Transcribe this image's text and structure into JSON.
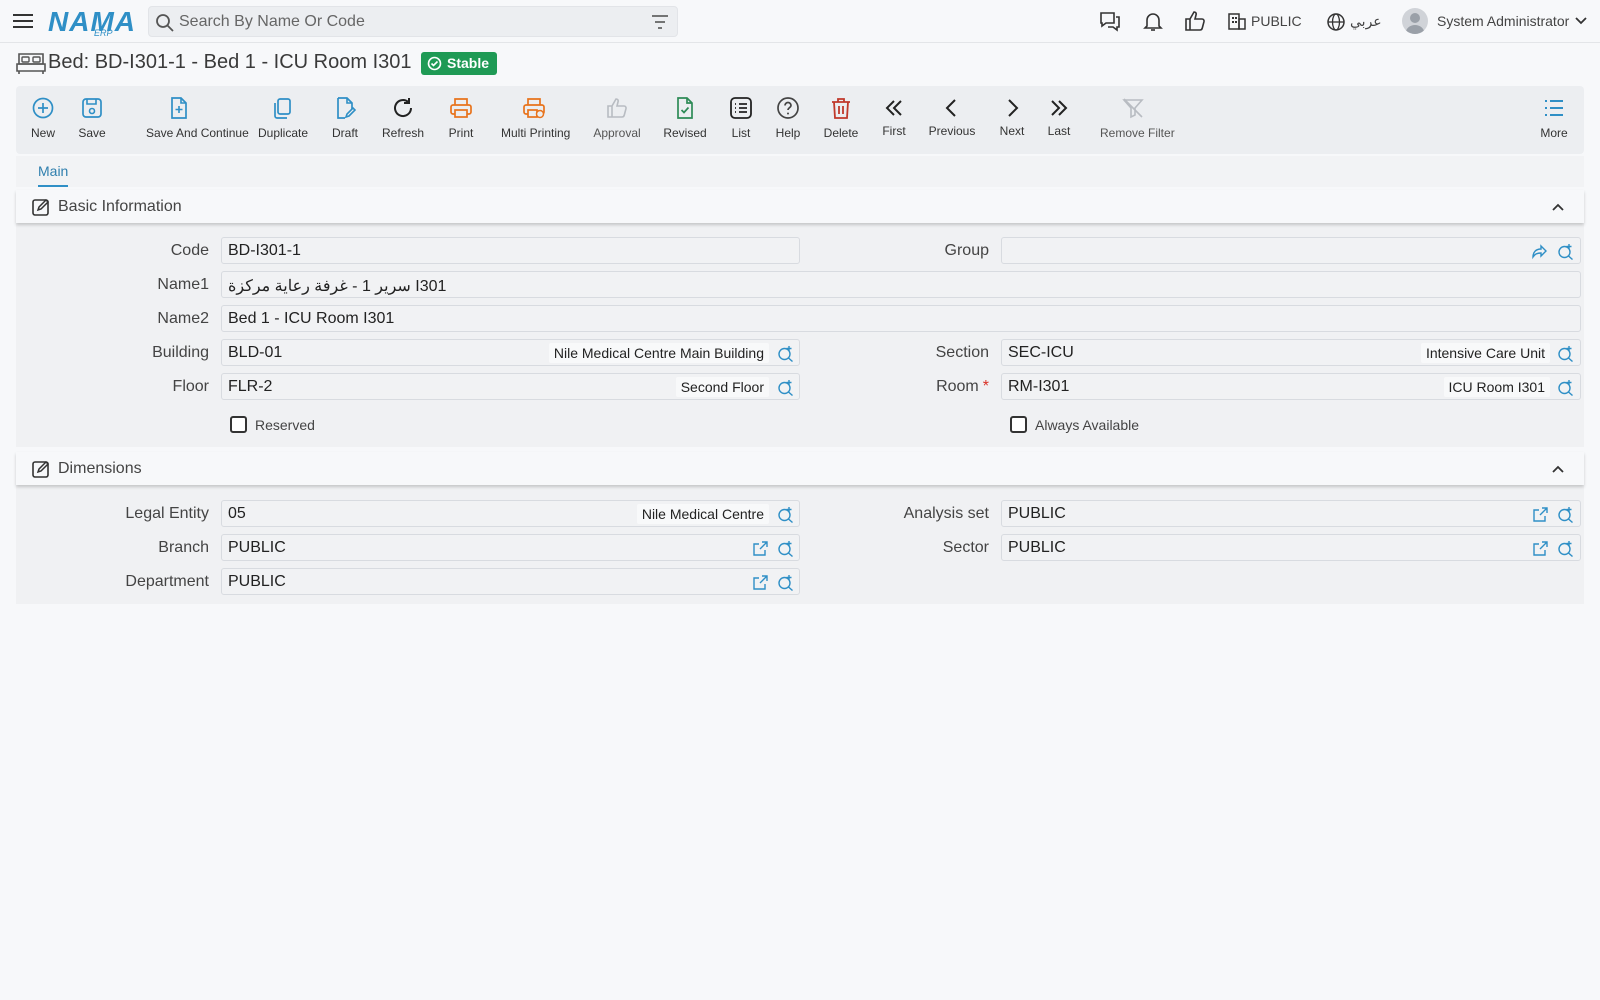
{
  "header": {
    "logo": "NAMA",
    "logo_sub": "ERP",
    "search_placeholder": "Search By Name Or Code",
    "org": "PUBLIC",
    "language": "عربي",
    "user": "System Administrator"
  },
  "page": {
    "title": "Bed: BD-I301-1 - Bed 1 - ICU Room I301",
    "status": "Stable"
  },
  "toolbar": {
    "new": "New",
    "save": "Save",
    "save_continue": "Save And Continue",
    "duplicate": "Duplicate",
    "draft": "Draft",
    "refresh": "Refresh",
    "print": "Print",
    "multi_printing": "Multi Printing",
    "approval": "Approval",
    "revised": "Revised",
    "list": "List",
    "help": "Help",
    "delete": "Delete",
    "first": "First",
    "previous": "Previous",
    "next": "Next",
    "last": "Last",
    "remove_filter": "Remove Filter",
    "more": "More"
  },
  "tabs": {
    "main": "Main"
  },
  "basic": {
    "title": "Basic Information",
    "code_label": "Code",
    "code": "BD-I301-1",
    "group_label": "Group",
    "group": "",
    "name1_label": "Name1",
    "name1": "سرير 1 - غرفة رعاية مركزة I301",
    "name2_label": "Name2",
    "name2": "Bed 1 - ICU Room I301",
    "building_label": "Building",
    "building": "BLD-01",
    "building_desc": "Nile Medical Centre Main Building",
    "section_label": "Section",
    "section": "SEC-ICU",
    "section_desc": "Intensive Care Unit",
    "floor_label": "Floor",
    "floor": "FLR-2",
    "floor_desc": "Second Floor",
    "room_label": "Room",
    "room_required": "*",
    "room": "RM-I301",
    "room_desc": "ICU Room I301",
    "reserved_label": "Reserved",
    "reserved": false,
    "always_available_label": "Always Available",
    "always_available": false
  },
  "dimensions": {
    "title": "Dimensions",
    "legal_entity_label": "Legal Entity",
    "legal_entity": "05",
    "legal_entity_desc": "Nile Medical Centre",
    "analysis_set_label": "Analysis set",
    "analysis_set": "PUBLIC",
    "branch_label": "Branch",
    "branch": "PUBLIC",
    "sector_label": "Sector",
    "sector": "PUBLIC",
    "department_label": "Department",
    "department": "PUBLIC"
  },
  "colors": {
    "accent": "#2f8fc6",
    "print_orange": "#e8731c",
    "delete_red": "#c0392b",
    "revised_green": "#2e8b57",
    "status_green": "#1f9a55"
  }
}
